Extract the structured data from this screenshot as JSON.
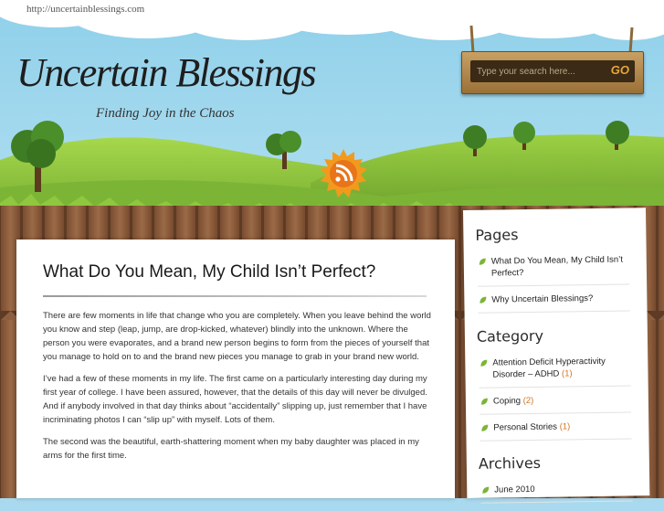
{
  "browser": {
    "url": "http://uncertainblessings.com"
  },
  "header": {
    "site_title": "Uncertain Blessings",
    "tagline": "Finding Joy in the Chaos",
    "search": {
      "placeholder": "Type your search here...",
      "button_label": "GO"
    }
  },
  "post": {
    "title": "What Do You Mean, My Child Isn’t Perfect?",
    "paragraphs": [
      "There are few moments in life that change who you are completely.  When you leave behind the world you know and step (leap, jump, are drop-kicked, whatever) blindly into the unknown.  Where the person you were evaporates, and a brand new person begins to form from the pieces of yourself that you manage to hold on to and the brand new pieces you manage to grab in your brand new world.",
      "I’ve had a few of these moments in my life.  The first came on a particularly interesting day during my first year of college.  I have been assured, however, that the details of this day will never be divulged.  And if anybody involved in that day thinks about “accidentally” slipping up, just remember that I have incriminating photos I can “slip up” with myself.  Lots of them.",
      "The second was the beautiful, earth-shattering moment when my baby daughter was placed in my arms for the first time."
    ]
  },
  "sidebar": {
    "pages": {
      "heading": "Pages",
      "items": [
        {
          "label": "What Do You Mean, My Child Isn’t Perfect?"
        },
        {
          "label": "Why Uncertain Blessings?"
        }
      ]
    },
    "category": {
      "heading": "Category",
      "items": [
        {
          "label": "Attention Deficit Hyperactivity Disorder – ADHD",
          "count": "(1)"
        },
        {
          "label": "Coping",
          "count": "(2)"
        },
        {
          "label": "Personal Stories",
          "count": "(1)"
        }
      ]
    },
    "archives": {
      "heading": "Archives",
      "items": [
        {
          "label": "June 2010"
        }
      ]
    }
  },
  "colors": {
    "sky": "#a9d9ee",
    "grass": "#8fc73e",
    "fence": "#8a5a3a",
    "accent": "#d2731f"
  },
  "icons": {
    "feed": "rss-icon",
    "bullet": "leaf-icon"
  }
}
